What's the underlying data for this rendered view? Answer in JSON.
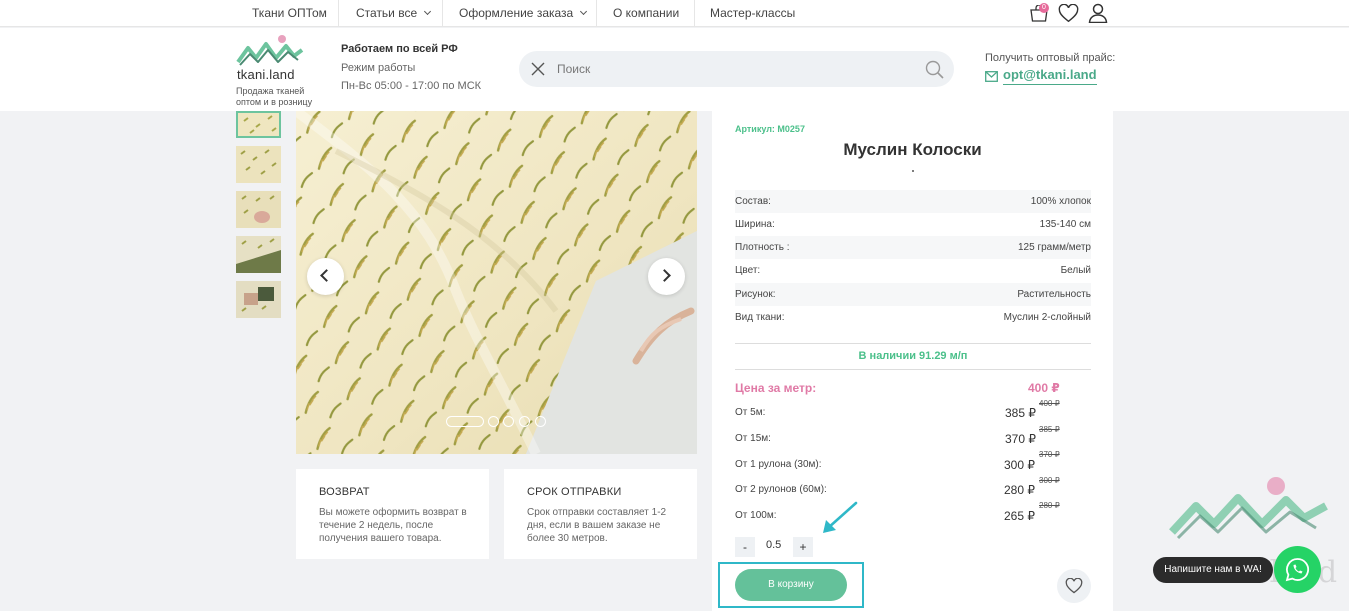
{
  "topnav": {
    "items": [
      "Ткани ОПТом",
      "Статьи все",
      "Оформление заказа",
      "О компании",
      "Мастер-классы"
    ],
    "cart_count": "0"
  },
  "header": {
    "logo_text": "tkani.land",
    "logo_sub": "Продажа тканей оптом и в розницу",
    "work_title": "Работаем по всей РФ",
    "work_mode": "Режим работы",
    "work_hours": "Пн-Вс 05:00 - 17:00 по МСК",
    "search_placeholder": "Поиск",
    "price_label": "Получить оптовый прайс:",
    "price_email": "opt@tkani.land"
  },
  "gallery": {
    "thumb_count": 5,
    "active_thumb": 0,
    "dot_count": 5,
    "active_dot": 0
  },
  "cards": [
    {
      "title": "ВОЗВРАТ",
      "text": "Вы можете оформить возврат в течение 2 недель, после получения вашего товара."
    },
    {
      "title": "СРОК ОТПРАВКИ",
      "text": "Срок отправки составляет 1-2 дня, если в вашем заказе не более 30 метров."
    }
  ],
  "product": {
    "sku": "Артикул: M0257",
    "title": "Муслин Колоски",
    "specs": [
      {
        "key": "Состав:",
        "value": "100% хлопок"
      },
      {
        "key": "Ширина:",
        "value": "135-140 см"
      },
      {
        "key": "Плотность :",
        "value": "125 грамм/метр"
      },
      {
        "key": "Цвет:",
        "value": "Белый"
      },
      {
        "key": "Рисунок:",
        "value": "Растительность"
      },
      {
        "key": "Вид ткани:",
        "value": "Муслин 2-слойный"
      }
    ],
    "stock": "В наличии 91.29 м/п",
    "price_title": "Цена за метр:",
    "price_main": "400 ₽",
    "tiers": [
      {
        "label": "От 5м:",
        "price": "385 ₽",
        "old": "400 ₽"
      },
      {
        "label": "От 15м:",
        "price": "370 ₽",
        "old": "385 ₽"
      },
      {
        "label": "От 1 рулона (30м):",
        "price": "300 ₽",
        "old": "370 ₽"
      },
      {
        "label": "От 2 рулонов (60м):",
        "price": "280 ₽",
        "old": "300 ₽"
      },
      {
        "label": "От 100м:",
        "price": "265 ₽",
        "old": "280 ₽"
      }
    ],
    "qty_minus": "-",
    "qty_value": "0.5",
    "qty_plus": "+",
    "cart_button": "В корзину"
  },
  "widget": {
    "wa_label": "Напишите нам в WA!",
    "watermark": "tkani.land"
  },
  "colors": {
    "accent_green": "#64c19a",
    "pink": "#e07aa6",
    "highlight": "#2fb8c8"
  }
}
